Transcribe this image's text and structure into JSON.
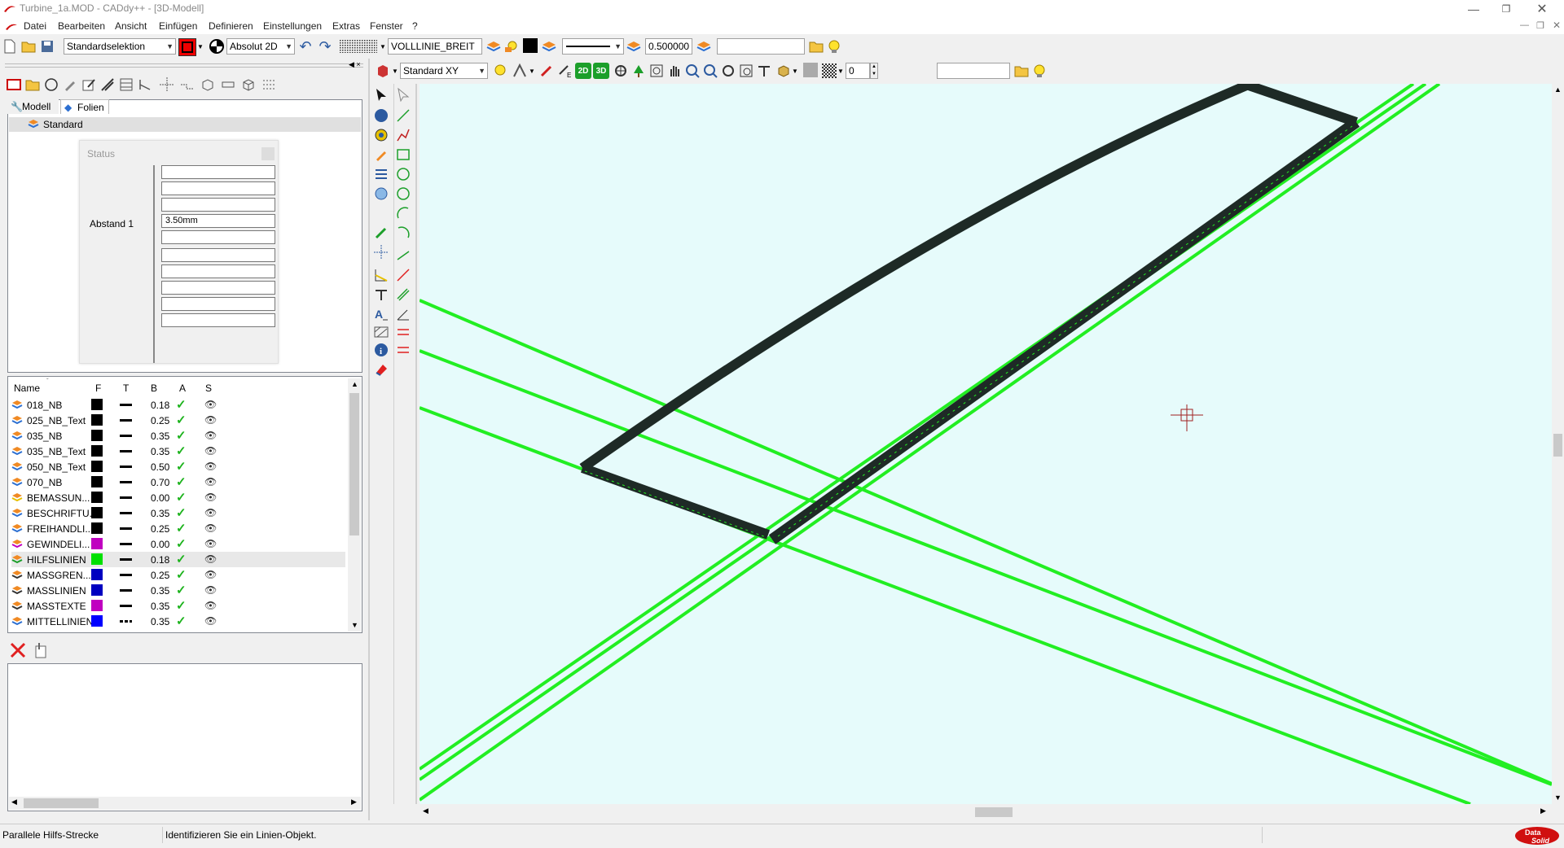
{
  "titlebar": {
    "title": "Turbine_1a.MOD  -  CADdy++ - [3D-Modell]"
  },
  "menubar": {
    "items": [
      "Datei",
      "Bearbeiten",
      "Ansicht",
      "Einfügen",
      "Definieren",
      "Einstellungen",
      "Extras",
      "Fenster",
      "?"
    ]
  },
  "toolbar1": {
    "selection_mode": "Standardselektion",
    "coord_mode": "Absolut 2D",
    "line_type": "VOLLLINIE_BREIT",
    "line_width": "0.500000",
    "layer_field": ""
  },
  "toolbar2": {
    "view": "Standard XY",
    "badge_2d": "2D",
    "badge_3d": "3D",
    "spin_value": "0",
    "value_field": ""
  },
  "leftpanel": {
    "tabs": [
      {
        "label": "Modell"
      },
      {
        "label": "Folien"
      }
    ],
    "tree_root": "Standard",
    "status_dialog": {
      "title": "Status",
      "label": "Abstand 1",
      "value": "3.50mm"
    },
    "layer_table": {
      "columns": [
        "Name",
        "F",
        "T",
        "B",
        "A",
        "S"
      ],
      "rows": [
        {
          "name": "018_NB",
          "color": "#000000",
          "width": "0.18",
          "line": "solid"
        },
        {
          "name": "025_NB_Text",
          "color": "#000000",
          "width": "0.25",
          "line": "solid"
        },
        {
          "name": "035_NB",
          "color": "#000000",
          "width": "0.35",
          "line": "solid"
        },
        {
          "name": "035_NB_Text",
          "color": "#000000",
          "width": "0.35",
          "line": "solid"
        },
        {
          "name": "050_NB_Text",
          "color": "#000000",
          "width": "0.50",
          "line": "solid"
        },
        {
          "name": "070_NB",
          "color": "#000000",
          "width": "0.70",
          "line": "solid"
        },
        {
          "name": "BEMASSUN...",
          "color": "#000000",
          "width": "0.00",
          "line": "solid"
        },
        {
          "name": "BESCHRIFTU...",
          "color": "#000000",
          "width": "0.35",
          "line": "solid"
        },
        {
          "name": "FREIHANDLI...",
          "color": "#000000",
          "width": "0.25",
          "line": "solid"
        },
        {
          "name": "GEWINDELI...",
          "color": "#c000c0",
          "width": "0.00",
          "line": "solid"
        },
        {
          "name": "HILFSLINIEN",
          "color": "#00e000",
          "width": "0.18",
          "line": "solid"
        },
        {
          "name": "MASSGREN...",
          "color": "#0000c0",
          "width": "0.25",
          "line": "solid"
        },
        {
          "name": "MASSLINIEN",
          "color": "#0000c0",
          "width": "0.35",
          "line": "solid"
        },
        {
          "name": "MASSTEXTE",
          "color": "#c000c0",
          "width": "0.35",
          "line": "solid"
        },
        {
          "name": "MITTELLINIEN",
          "color": "#0000ff",
          "width": "0.35",
          "line": "dash"
        }
      ]
    }
  },
  "statusbar": {
    "command": "Parallele Hilfs-Strecke",
    "prompt": "Identifizieren Sie ein Linien-Objekt."
  },
  "colors": {
    "canvas_bg": "#e6fbfb",
    "helper_line": "#22ee22",
    "profile_dark": "#1e2a26"
  }
}
